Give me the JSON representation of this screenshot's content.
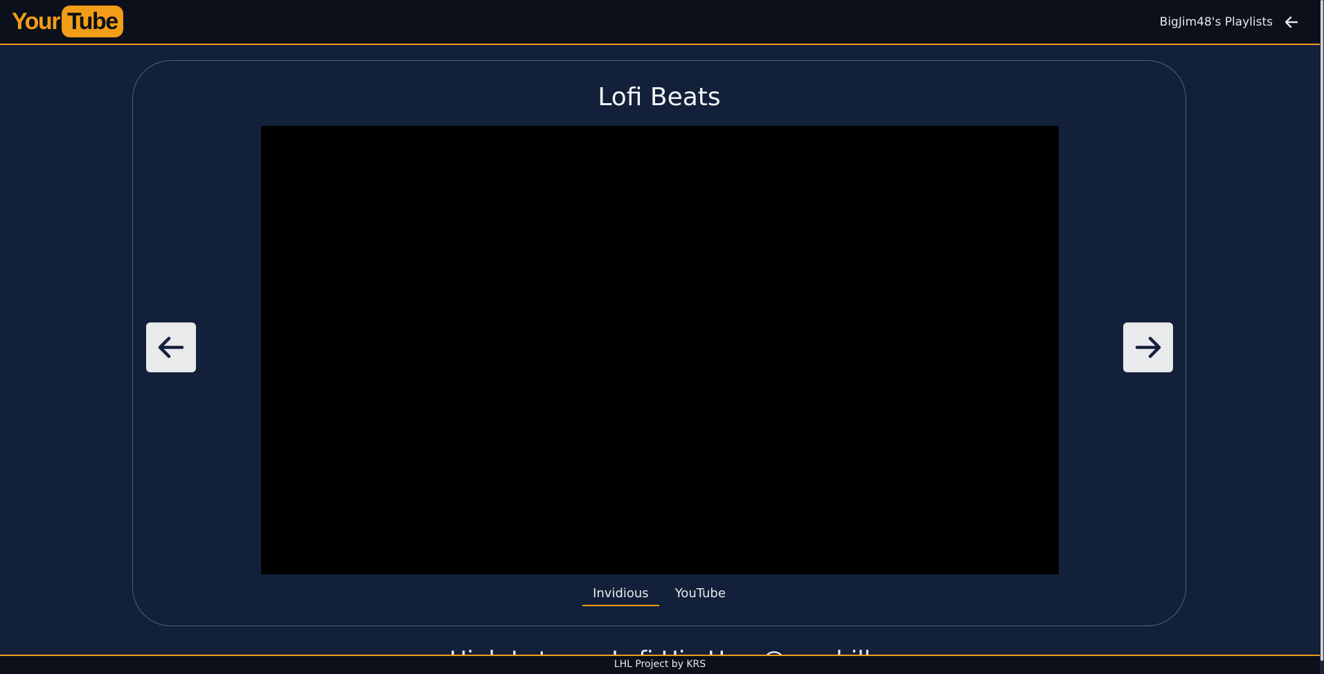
{
  "brand": {
    "part1": "Your",
    "part2": "Tube"
  },
  "nav": {
    "user_playlists": "BigJim48's Playlists",
    "back_icon": "arrow-left-icon"
  },
  "playlist": {
    "title": "Lofi Beats"
  },
  "controls": {
    "prev_icon": "arrow-left-icon",
    "next_icon": "arrow-right-icon"
  },
  "tabs": [
    {
      "label": "Invidious",
      "active": true
    },
    {
      "label": "YouTube",
      "active": false
    }
  ],
  "partial_text": "High Latency Lofi Hip Hop @ ... chill",
  "footer": {
    "text": "LHL Project by KRS"
  },
  "colors": {
    "accent": "#f29d17",
    "background": "#132039",
    "navbar": "#0b101a"
  }
}
